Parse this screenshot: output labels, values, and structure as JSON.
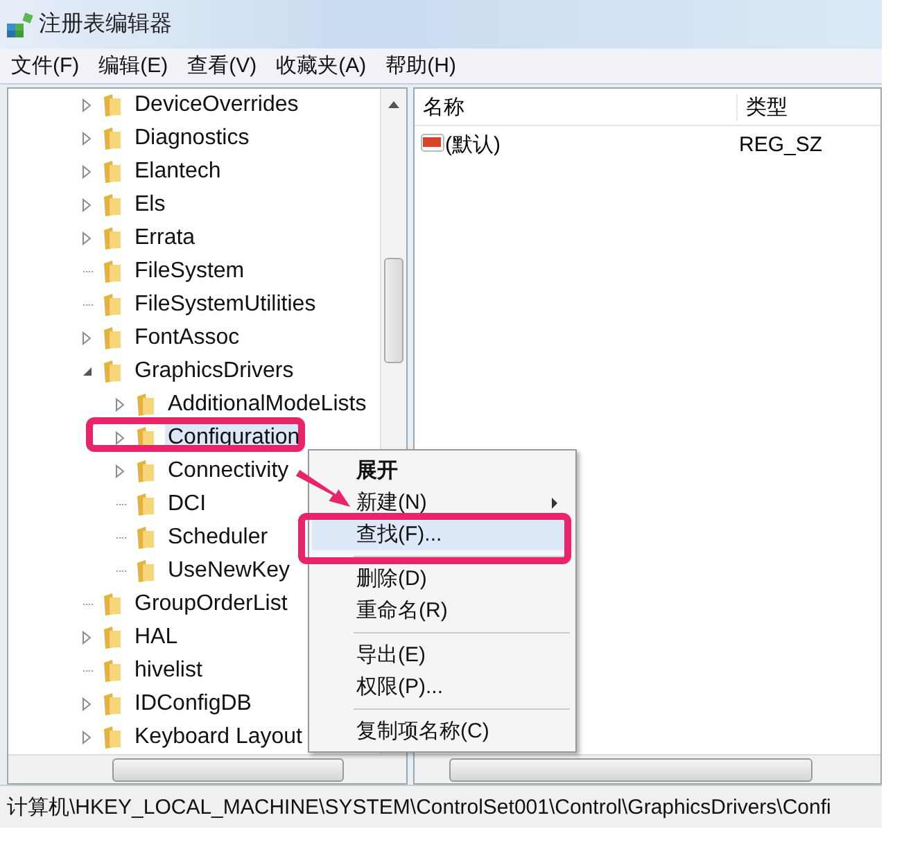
{
  "window": {
    "title": "注册表编辑器"
  },
  "menu_bar": [
    "文件(F)",
    "编辑(E)",
    "查看(V)",
    "收藏夹(A)",
    "帮助(H)"
  ],
  "tree": {
    "items": [
      {
        "label": "DeviceOverrides",
        "has_children": true,
        "expanded": false,
        "selected": false
      },
      {
        "label": "Diagnostics",
        "has_children": true,
        "expanded": false,
        "selected": false
      },
      {
        "label": "Elantech",
        "has_children": true,
        "expanded": false,
        "selected": false
      },
      {
        "label": "Els",
        "has_children": true,
        "expanded": false,
        "selected": false
      },
      {
        "label": "Errata",
        "has_children": true,
        "expanded": false,
        "selected": false
      },
      {
        "label": "FileSystem",
        "has_children": false,
        "selected": false
      },
      {
        "label": "FileSystemUtilities",
        "has_children": false,
        "selected": false
      },
      {
        "label": "FontAssoc",
        "has_children": true,
        "expanded": false,
        "selected": false
      },
      {
        "label": "GraphicsDrivers",
        "has_children": true,
        "expanded": true,
        "selected": false,
        "children": [
          {
            "label": "AdditionalModeLists",
            "has_children": true,
            "expanded": false,
            "selected": false
          },
          {
            "label": "Configuration",
            "has_children": true,
            "expanded": false,
            "selected": true
          },
          {
            "label": "Connectivity",
            "has_children": true,
            "expanded": false,
            "selected": false
          },
          {
            "label": "DCI",
            "has_children": false,
            "selected": false
          },
          {
            "label": "Scheduler",
            "has_children": false,
            "selected": false
          },
          {
            "label": "UseNewKey",
            "has_children": false,
            "selected": false
          }
        ]
      },
      {
        "label": "GroupOrderList",
        "has_children": false,
        "selected": false
      },
      {
        "label": "HAL",
        "has_children": true,
        "expanded": false,
        "selected": false
      },
      {
        "label": "hivelist",
        "has_children": false,
        "selected": false
      },
      {
        "label": "IDConfigDB",
        "has_children": true,
        "expanded": false,
        "selected": false
      },
      {
        "label": "Keyboard Layout",
        "has_children": true,
        "expanded": false,
        "selected": false
      }
    ]
  },
  "values": {
    "columns": [
      "名称",
      "类型"
    ],
    "rows": [
      {
        "name": "(默认)",
        "type": "REG_SZ"
      }
    ]
  },
  "context_menu": {
    "groups": [
      [
        {
          "label": "展开",
          "default": true,
          "submenu": false,
          "selected": false
        },
        {
          "label": "新建(N)",
          "default": false,
          "submenu": true,
          "selected": false
        },
        {
          "label": "查找(F)...",
          "default": false,
          "submenu": false,
          "selected": true
        }
      ],
      [
        {
          "label": "删除(D)",
          "default": false,
          "submenu": false,
          "selected": false
        },
        {
          "label": "重命名(R)",
          "default": false,
          "submenu": false,
          "selected": false
        }
      ],
      [
        {
          "label": "导出(E)",
          "default": false,
          "submenu": false,
          "selected": false
        },
        {
          "label": "权限(P)...",
          "default": false,
          "submenu": false,
          "selected": false
        }
      ],
      [
        {
          "label": "复制项名称(C)",
          "default": false,
          "submenu": false,
          "selected": false
        }
      ]
    ]
  },
  "status_bar": "计算机\\HKEY_LOCAL_MACHINE\\SYSTEM\\ControlSet001\\Control\\GraphicsDrivers\\Confi"
}
